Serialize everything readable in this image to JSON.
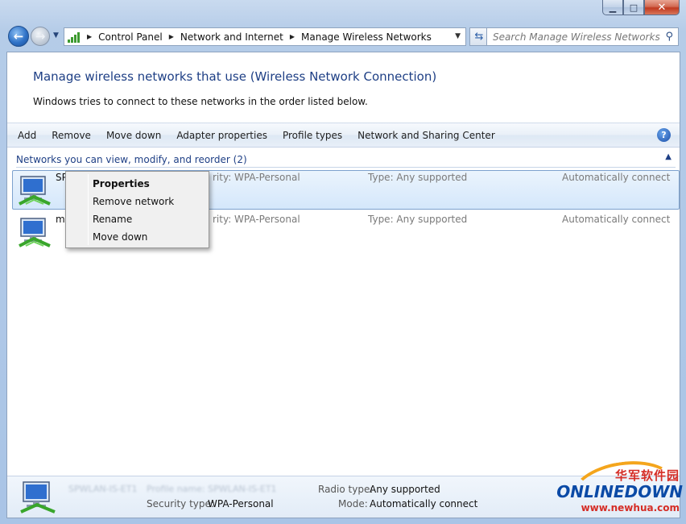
{
  "window": {
    "min_glyph": "▁",
    "max_glyph": "□",
    "close_glyph": "✕"
  },
  "nav": {
    "breadcrumbs": [
      "Control Panel",
      "Network and Internet",
      "Manage Wireless Networks"
    ],
    "search_placeholder": "Search Manage Wireless Networks"
  },
  "page": {
    "title": "Manage wireless networks that use (Wireless Network Connection)",
    "description": "Windows tries to connect to these networks in the order listed below."
  },
  "toolbar": {
    "buttons": [
      "Add",
      "Remove",
      "Move down",
      "Adapter properties",
      "Profile types",
      "Network and Sharing Center"
    ],
    "help": "?"
  },
  "group": {
    "header": "Networks you can view, modify, and reorder (2)"
  },
  "networks": [
    {
      "name_visible": "SP",
      "security": "rity:  WPA-Personal",
      "type": "Type:  Any supported",
      "mode": "Automatically connect",
      "selected": true
    },
    {
      "name_visible": "m",
      "security": "rity:  WPA-Personal",
      "type": "Type:  Any supported",
      "mode": "Automatically connect",
      "selected": false
    }
  ],
  "context_menu": {
    "items": [
      "Properties",
      "Remove network",
      "Rename",
      "Move down"
    ]
  },
  "details": {
    "name_blurred": "SPWLAN-IS-ET1",
    "profile_label_blurred": "Profile name:  SPWLAN-IS-ET1",
    "security_label": "Security type:",
    "security_value": "WPA-Personal",
    "radio_label": "Radio type:",
    "radio_value": "Any supported",
    "mode_label": "Mode:",
    "mode_value": "Automatically connect"
  },
  "watermark": {
    "chinese": "华军软件园",
    "brand": "ONLINEDOWN",
    "url": "www.newhua.com"
  }
}
